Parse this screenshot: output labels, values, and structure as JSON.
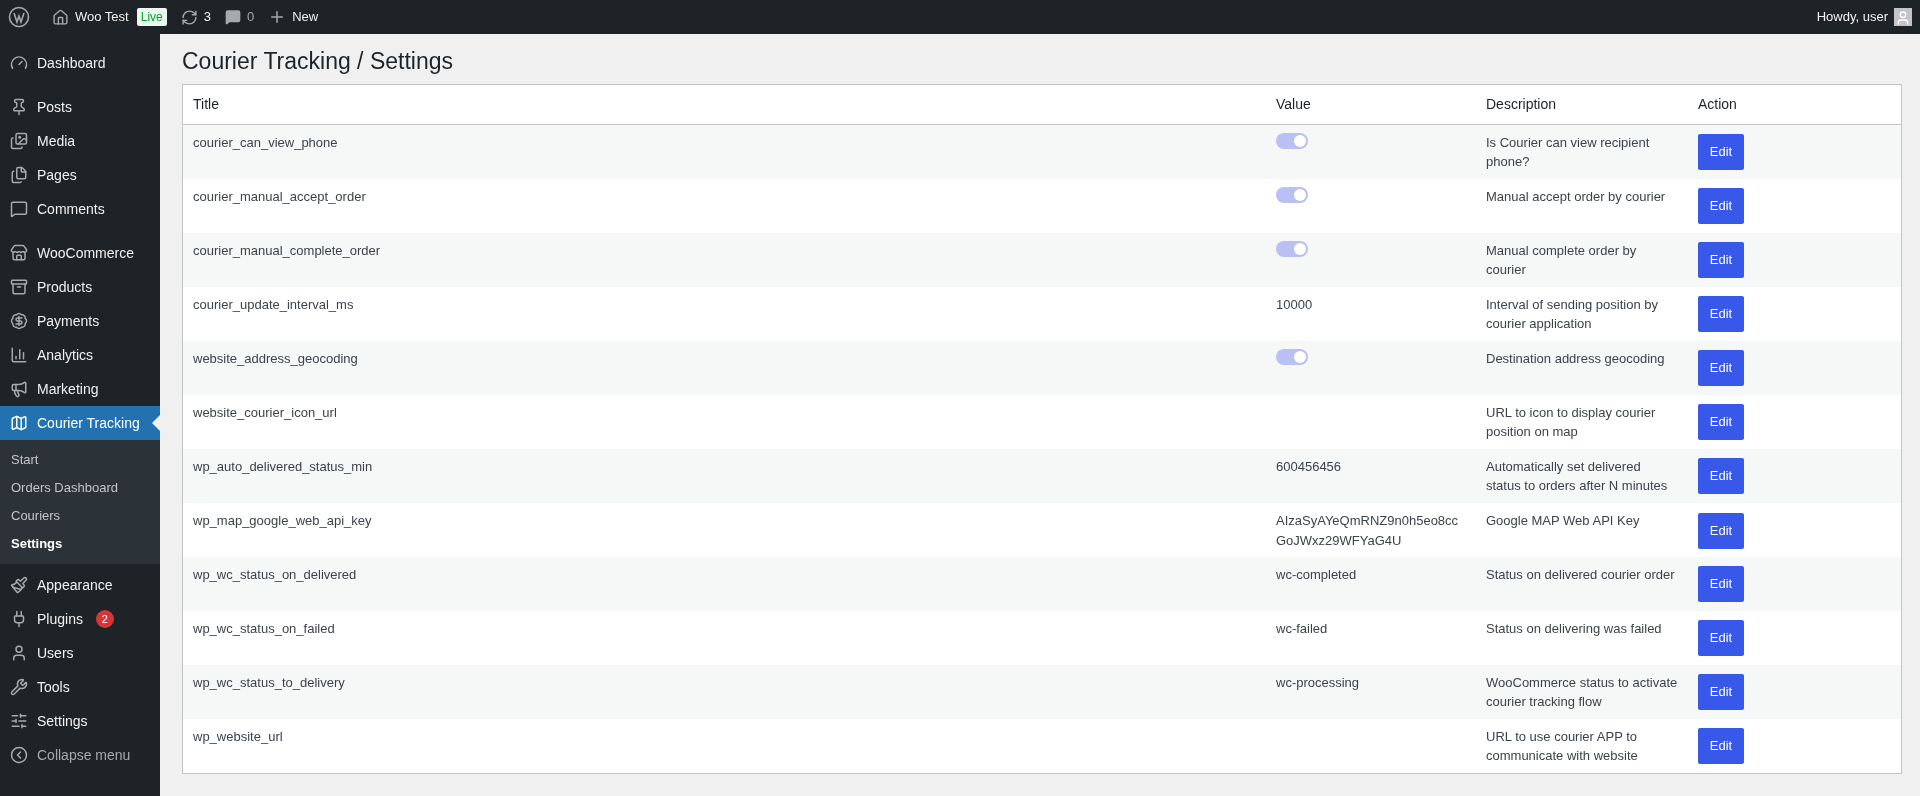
{
  "top_bar": {
    "site_name": "Woo Test",
    "live_badge": "Live",
    "updates_count": "3",
    "comments_count": "0",
    "new_label": "New",
    "greeting": "Howdy, user"
  },
  "sidebar": {
    "groups": [
      [
        {
          "label": "Dashboard",
          "selected": false
        }
      ],
      [
        {
          "label": "Posts",
          "selected": false
        },
        {
          "label": "Media",
          "selected": false
        },
        {
          "label": "Pages",
          "selected": false
        },
        {
          "label": "Comments",
          "selected": false
        }
      ],
      [
        {
          "label": "WooCommerce",
          "selected": false
        },
        {
          "label": "Products",
          "selected": false
        },
        {
          "label": "Payments",
          "selected": false
        },
        {
          "label": "Analytics",
          "selected": false
        },
        {
          "label": "Marketing",
          "selected": false
        },
        {
          "label": "Courier Tracking",
          "selected": true,
          "children": [
            {
              "label": "Start",
              "selected": false
            },
            {
              "label": "Orders Dashboard",
              "selected": false
            },
            {
              "label": "Couriers",
              "selected": false
            },
            {
              "label": "Settings",
              "selected": true
            }
          ]
        }
      ],
      [
        {
          "label": "Appearance",
          "selected": false
        },
        {
          "label": "Plugins",
          "selected": false,
          "badge": "2"
        },
        {
          "label": "Users",
          "selected": false
        },
        {
          "label": "Tools",
          "selected": false
        },
        {
          "label": "Settings",
          "selected": false
        },
        {
          "label": "Collapse menu",
          "selected": false
        }
      ]
    ]
  },
  "page_title": "Courier Tracking / Settings",
  "table": {
    "columns": [
      "Title",
      "Value",
      "Description",
      "Action"
    ],
    "rows": [
      {
        "title": "courier_can_view_phone",
        "kind": "toggle",
        "on": true,
        "description": "Is Courier can view recipient phone?",
        "action": "Edit"
      },
      {
        "title": "courier_manual_accept_order",
        "kind": "toggle",
        "on": true,
        "description": "Manual accept order by courier",
        "action": "Edit"
      },
      {
        "title": "courier_manual_complete_order",
        "kind": "toggle",
        "on": true,
        "description": "Manual complete order by courier",
        "action": "Edit"
      },
      {
        "title": "courier_update_interval_ms",
        "kind": "text",
        "value": "10000",
        "description": "Interval of sending position by courier application",
        "action": "Edit"
      },
      {
        "title": "website_address_geocoding",
        "kind": "toggle",
        "on": true,
        "description": "Destination address geocoding",
        "action": "Edit"
      },
      {
        "title": "website_courier_icon_url",
        "kind": "text",
        "description": "URL to icon to display courier position on map",
        "action": "Edit"
      },
      {
        "title": "wp_auto_delivered_status_min",
        "kind": "text",
        "value": "600456456",
        "description": "Automatically set delivered status to orders after N minutes",
        "action": "Edit"
      },
      {
        "title": "wp_map_google_web_api_key",
        "kind": "text",
        "value": "AIzaSyAYeQmRNZ9n0h5eo8ccGoJWxz29WFYaG4U",
        "description": "Google MAP Web API Key",
        "action": "Edit"
      },
      {
        "title": "wp_wc_status_on_delivered",
        "kind": "text",
        "value": "wc-completed",
        "description": "Status on delivered courier order",
        "action": "Edit"
      },
      {
        "title": "wp_wc_status_on_failed",
        "kind": "text",
        "value": "wc-failed",
        "description": "Status on delivering was failed",
        "action": "Edit"
      },
      {
        "title": "wp_wc_status_to_delivery",
        "kind": "text",
        "value": "wc-processing",
        "description": "WooCommerce status to activate courier tracking flow",
        "action": "Edit"
      },
      {
        "title": "wp_website_url",
        "kind": "text",
        "description": "URL to use courier APP to communicate with website",
        "action": "Edit"
      }
    ]
  }
}
